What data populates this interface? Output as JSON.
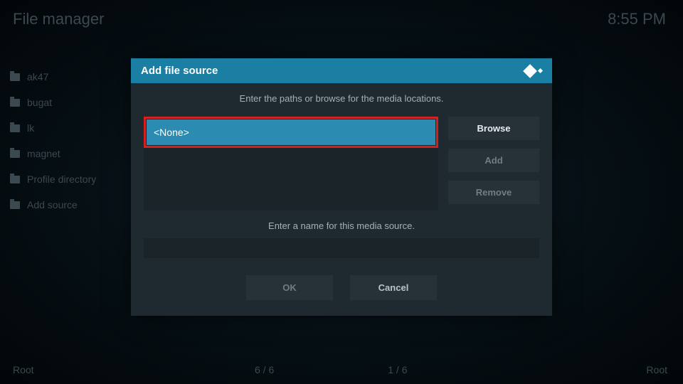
{
  "header": {
    "title": "File manager",
    "time": "8:55 PM"
  },
  "sidebar": {
    "items": [
      {
        "label": "ak47"
      },
      {
        "label": "bugat"
      },
      {
        "label": "lk"
      },
      {
        "label": "magnet"
      },
      {
        "label": "Profile directory"
      },
      {
        "label": "Add source"
      }
    ]
  },
  "dialog": {
    "title": "Add file source",
    "instruction": "Enter the paths or browse for the media locations.",
    "path_value": "<None>",
    "browse_label": "Browse",
    "add_label": "Add",
    "remove_label": "Remove",
    "name_instruction": "Enter a name for this media source.",
    "name_value": "",
    "ok_label": "OK",
    "cancel_label": "Cancel"
  },
  "footer": {
    "left_label": "Root",
    "count_left": "6 / 6",
    "count_right": "1 / 6",
    "right_label": "Root"
  }
}
